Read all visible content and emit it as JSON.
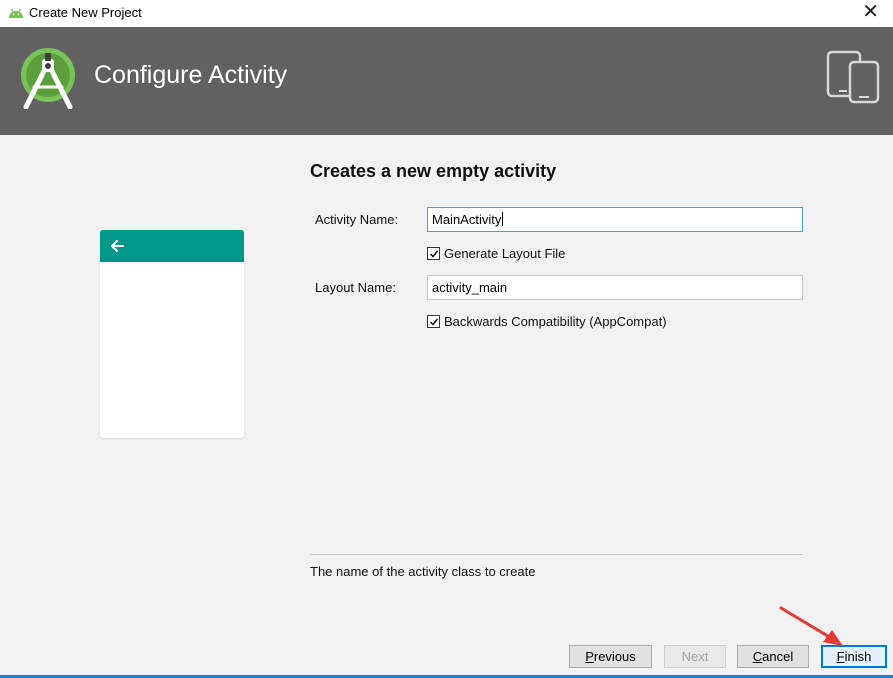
{
  "window": {
    "title": "Create New Project",
    "close_glyph": "✕"
  },
  "banner": {
    "heading": "Configure Activity",
    "logo_icon": "android-studio-logo-icon",
    "devices_icon": "devices-icon"
  },
  "preview": {
    "appbar_color": "#009688",
    "back_icon": "arrow-left-icon"
  },
  "form": {
    "heading": "Creates a new empty activity",
    "activity_name_label": "Activity Name:",
    "activity_name_value": "MainActivity",
    "generate_layout_label": "Generate Layout File",
    "generate_layout_checked": true,
    "layout_name_label": "Layout Name:",
    "layout_name_value": "activity_main",
    "backwards_compat_label": "Backwards Compatibility (AppCompat)",
    "backwards_compat_checked": true
  },
  "hint": "The name of the activity class to create",
  "buttons": {
    "previous": {
      "mnemonic": "P",
      "rest": "revious"
    },
    "next": "Next",
    "cancel": {
      "mnemonic": "C",
      "rest": "ancel"
    },
    "finish": {
      "mnemonic": "F",
      "rest": "inish"
    }
  },
  "colors": {
    "banner_bg": "#616161",
    "android_green": "#78c257",
    "annotation_red": "#e53935"
  }
}
